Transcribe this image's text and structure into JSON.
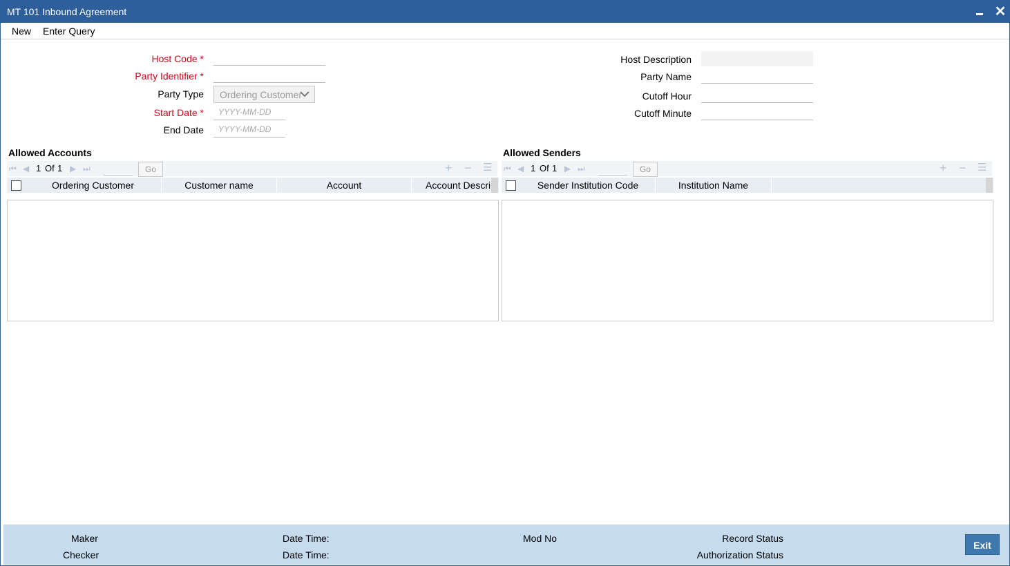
{
  "window": {
    "title": "MT 101 Inbound Agreement"
  },
  "menu": {
    "new": "New",
    "enter_query": "Enter Query"
  },
  "form": {
    "host_code": {
      "label": "Host Code",
      "required_mark": "*",
      "value": ""
    },
    "party_identifier": {
      "label": "Party Identifier",
      "required_mark": "*",
      "value": ""
    },
    "party_type": {
      "label": "Party Type",
      "selected": "Ordering Customer"
    },
    "start_date": {
      "label": "Start Date",
      "required_mark": "*",
      "placeholder": "YYYY-MM-DD"
    },
    "end_date": {
      "label": "End Date",
      "placeholder": "YYYY-MM-DD"
    },
    "host_description": {
      "label": "Host Description",
      "value": ""
    },
    "party_name": {
      "label": "Party Name",
      "value": ""
    },
    "cutoff_hour": {
      "label": "Cutoff Hour",
      "value": ""
    },
    "cutoff_minute": {
      "label": "Cutoff Minute",
      "value": ""
    }
  },
  "allowed_accounts": {
    "title": "Allowed Accounts",
    "pager": {
      "current": "1",
      "of_label": "Of",
      "total": "1",
      "go_label": "Go"
    },
    "columns": [
      "Ordering Customer",
      "Customer name",
      "Account",
      "Account Descripti"
    ],
    "rows": []
  },
  "allowed_senders": {
    "title": "Allowed Senders",
    "pager": {
      "current": "1",
      "of_label": "Of",
      "total": "1",
      "go_label": "Go"
    },
    "columns": [
      "Sender Institution Code",
      "Institution Name"
    ],
    "rows": []
  },
  "footer": {
    "maker": "Maker",
    "checker": "Checker",
    "date_time_1": "Date Time:",
    "date_time_2": "Date Time:",
    "mod_no": "Mod No",
    "record_status": "Record Status",
    "authorization_status": "Authorization Status",
    "exit": "Exit"
  },
  "colors": {
    "titlebar": "#2e5f9a",
    "required": "#d0021b",
    "footer": "#c6dcee",
    "exit_button": "#3e78ad"
  }
}
